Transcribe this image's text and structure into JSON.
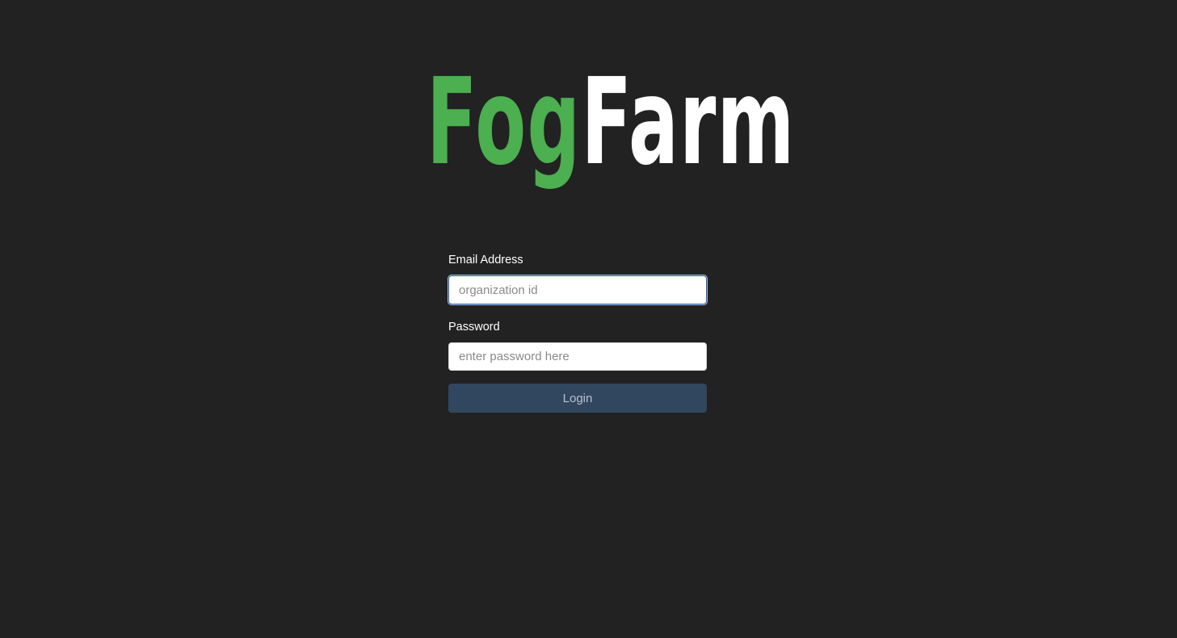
{
  "logo": {
    "part1": "Fog",
    "part2": "Farm",
    "part1_color": "#4caf50",
    "part2_color": "#ffffff"
  },
  "login_form": {
    "email_label": "Email Address",
    "email_placeholder": "organization id",
    "email_value": "",
    "password_label": "Password",
    "password_placeholder": "enter password here",
    "password_value": "",
    "login_label": "Login"
  },
  "colors": {
    "background": "#222222",
    "accent": "#4caf50",
    "button": "#31465f"
  }
}
